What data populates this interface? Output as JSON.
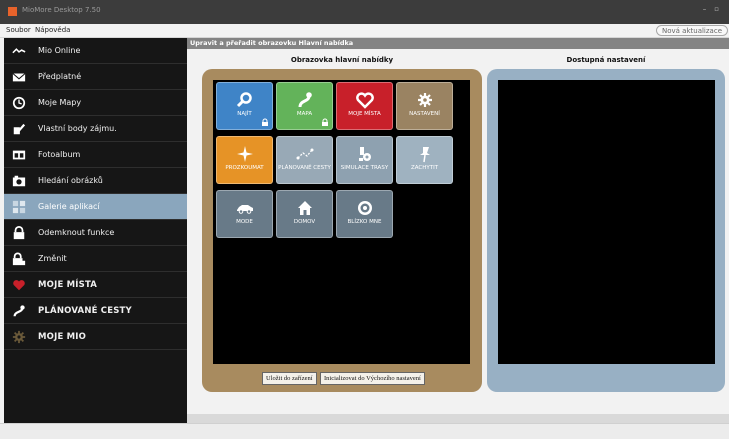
{
  "window": {
    "title": "MioMore Desktop 7.50"
  },
  "menu": {
    "items": [
      "Soubor",
      "Nápověda"
    ],
    "update_button": "Nová aktualizace"
  },
  "sidebar": {
    "items": [
      {
        "label": "Mio Online",
        "icon": "mio-online-icon"
      },
      {
        "label": "Předplatné",
        "icon": "envelope-icon"
      },
      {
        "label": "Moje Mapy",
        "icon": "clock-icon"
      },
      {
        "label": "Vlastní body zájmu.",
        "icon": "edit-icon"
      },
      {
        "label": "Fotoalbum",
        "icon": "photo-album-icon"
      },
      {
        "label": "Hledání obrázků",
        "icon": "camera-icon"
      },
      {
        "label": "Galerie aplikací",
        "icon": "gallery-icon"
      },
      {
        "label": "Odemknout funkce",
        "icon": "lock-icon"
      },
      {
        "label": "Změnit",
        "icon": "lock-change-icon"
      },
      {
        "label": "MOJE MÍSTA",
        "icon": "heart-icon"
      },
      {
        "label": "PLÁNOVANÉ CESTY",
        "icon": "route-icon"
      },
      {
        "label": "MOJE MIO",
        "icon": "gear-icon"
      }
    ],
    "active_index": 6
  },
  "main": {
    "header": "Upravit a přeřadit obrazovku Hlavní nabídka",
    "left_title": "Obrazovka hlavní nabídky",
    "right_title": "Dostupná nastavení",
    "tiles": [
      {
        "label": "NAJÍT",
        "color": "#3f84c7",
        "icon": "search-icon",
        "locked": true
      },
      {
        "label": "MAPA",
        "color": "#63b35a",
        "icon": "map-route-icon",
        "locked": true
      },
      {
        "label": "MOJE MÍSTA",
        "color": "#c8202a",
        "icon": "heart-icon",
        "locked": false
      },
      {
        "label": "NASTAVENÍ",
        "color": "#9a8362",
        "icon": "gear-icon",
        "locked": false
      },
      {
        "label": "PROZKOUMAT",
        "color": "#e69326",
        "icon": "sparkle-icon",
        "locked": false
      },
      {
        "label": "PLÁNOVANÉ CESTY",
        "color": "#98a9b6",
        "icon": "route-plan-icon",
        "locked": false
      },
      {
        "label": "SIMULACE TRASY",
        "color": "#8ea1b0",
        "icon": "simulation-icon",
        "locked": false
      },
      {
        "label": "ZACHYTIT",
        "color": "#9fb2c0",
        "icon": "pin-icon",
        "locked": false
      },
      {
        "label": "MODE",
        "color": "#687a88",
        "icon": "car-icon",
        "locked": false
      },
      {
        "label": "DOMOV",
        "color": "#687a88",
        "icon": "home-icon",
        "locked": false
      },
      {
        "label": "BLÍZKO MNE",
        "color": "#687a88",
        "icon": "nearby-icon",
        "locked": false
      }
    ],
    "save_button": "Uložit do zařízení",
    "reset_button": "Inicializovat do Výchozího nastavení"
  }
}
